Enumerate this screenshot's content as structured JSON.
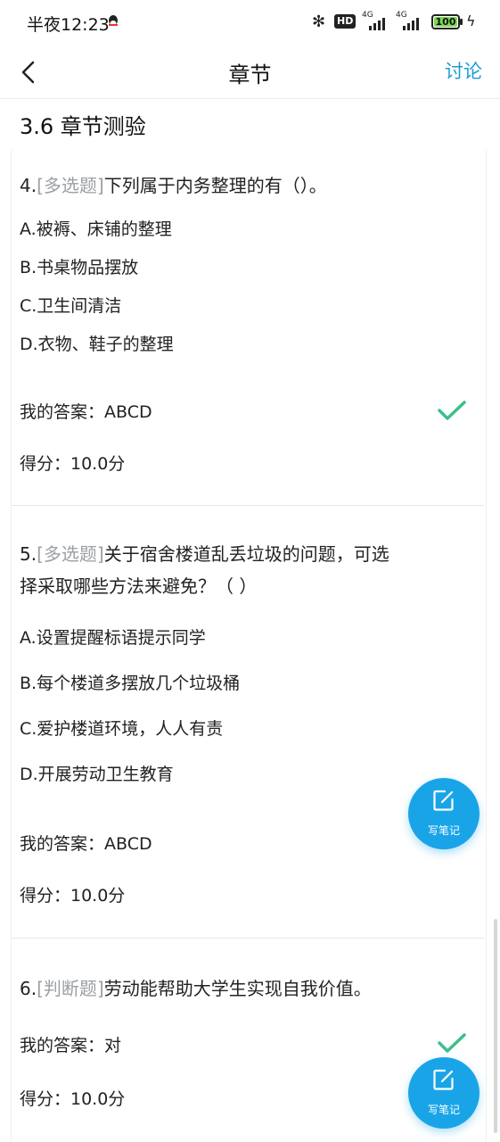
{
  "status_bar": {
    "time": "半夜12:23",
    "hd": "HD",
    "signal1_label": "4G",
    "signal2_label": "4G",
    "battery": "100"
  },
  "header": {
    "title": "章节",
    "discuss": "讨论"
  },
  "section_title": "3.6 章节测验",
  "questions": [
    {
      "number": "4.",
      "type": "[多选题]",
      "text": "下列属于内务整理的有（）。",
      "options": [
        "A.被褥、床铺的整理",
        "B.书桌物品摆放",
        "C.卫生间清洁",
        "D.衣物、鞋子的整理"
      ],
      "my_answer": "我的答案：ABCD",
      "score": "得分：10.0分"
    },
    {
      "number": "5.",
      "type": "[多选题]",
      "text_line1": "关于宿舍楼道乱丢垃圾的问题，可选",
      "text_line2": "择采取哪些方法来避免？（ ）",
      "options": [
        "A.设置提醒标语提示同学",
        "B.每个楼道多摆放几个垃圾桶",
        "C.爱护楼道环境，人人有责",
        "D.开展劳动卫生教育"
      ],
      "my_answer": "我的答案：ABCD",
      "score": "得分：10.0分"
    },
    {
      "number": "6.",
      "type": "[判断题]",
      "text": "劳动能帮助大学生实现自我价值。",
      "my_answer": "我的答案：对",
      "score": "得分：10.0分"
    }
  ],
  "fab": {
    "label": "写笔记"
  },
  "colors": {
    "accent": "#1a9bd7",
    "check": "#3cc08a",
    "fab": "#1aa4e8",
    "muted": "#9aa0a6"
  }
}
